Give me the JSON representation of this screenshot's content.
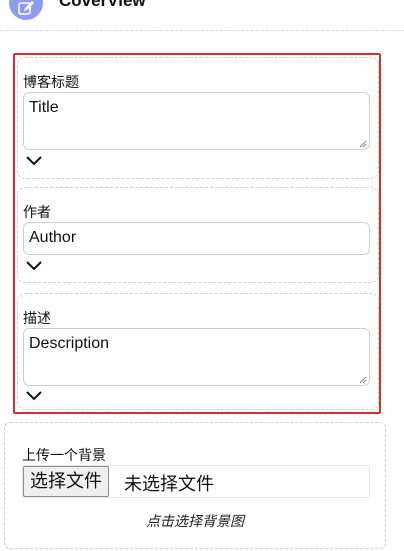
{
  "app": {
    "title": "CoverView"
  },
  "form": {
    "fields": [
      {
        "label": "博客标题",
        "value": "Title",
        "type": "textarea"
      },
      {
        "label": "作者",
        "value": "Author",
        "type": "input"
      },
      {
        "label": "描述",
        "value": "Description",
        "type": "textarea"
      }
    ]
  },
  "upload": {
    "label": "上传一个背景",
    "button_label": "选择文件",
    "status": "未选择文件",
    "hint": "点击选择背景图"
  },
  "colors": {
    "accent": "#8e9bf2",
    "highlight_border": "#d32f2f"
  },
  "icons": {
    "logo": "edit-icon",
    "expand": "chevron-down-icon"
  }
}
